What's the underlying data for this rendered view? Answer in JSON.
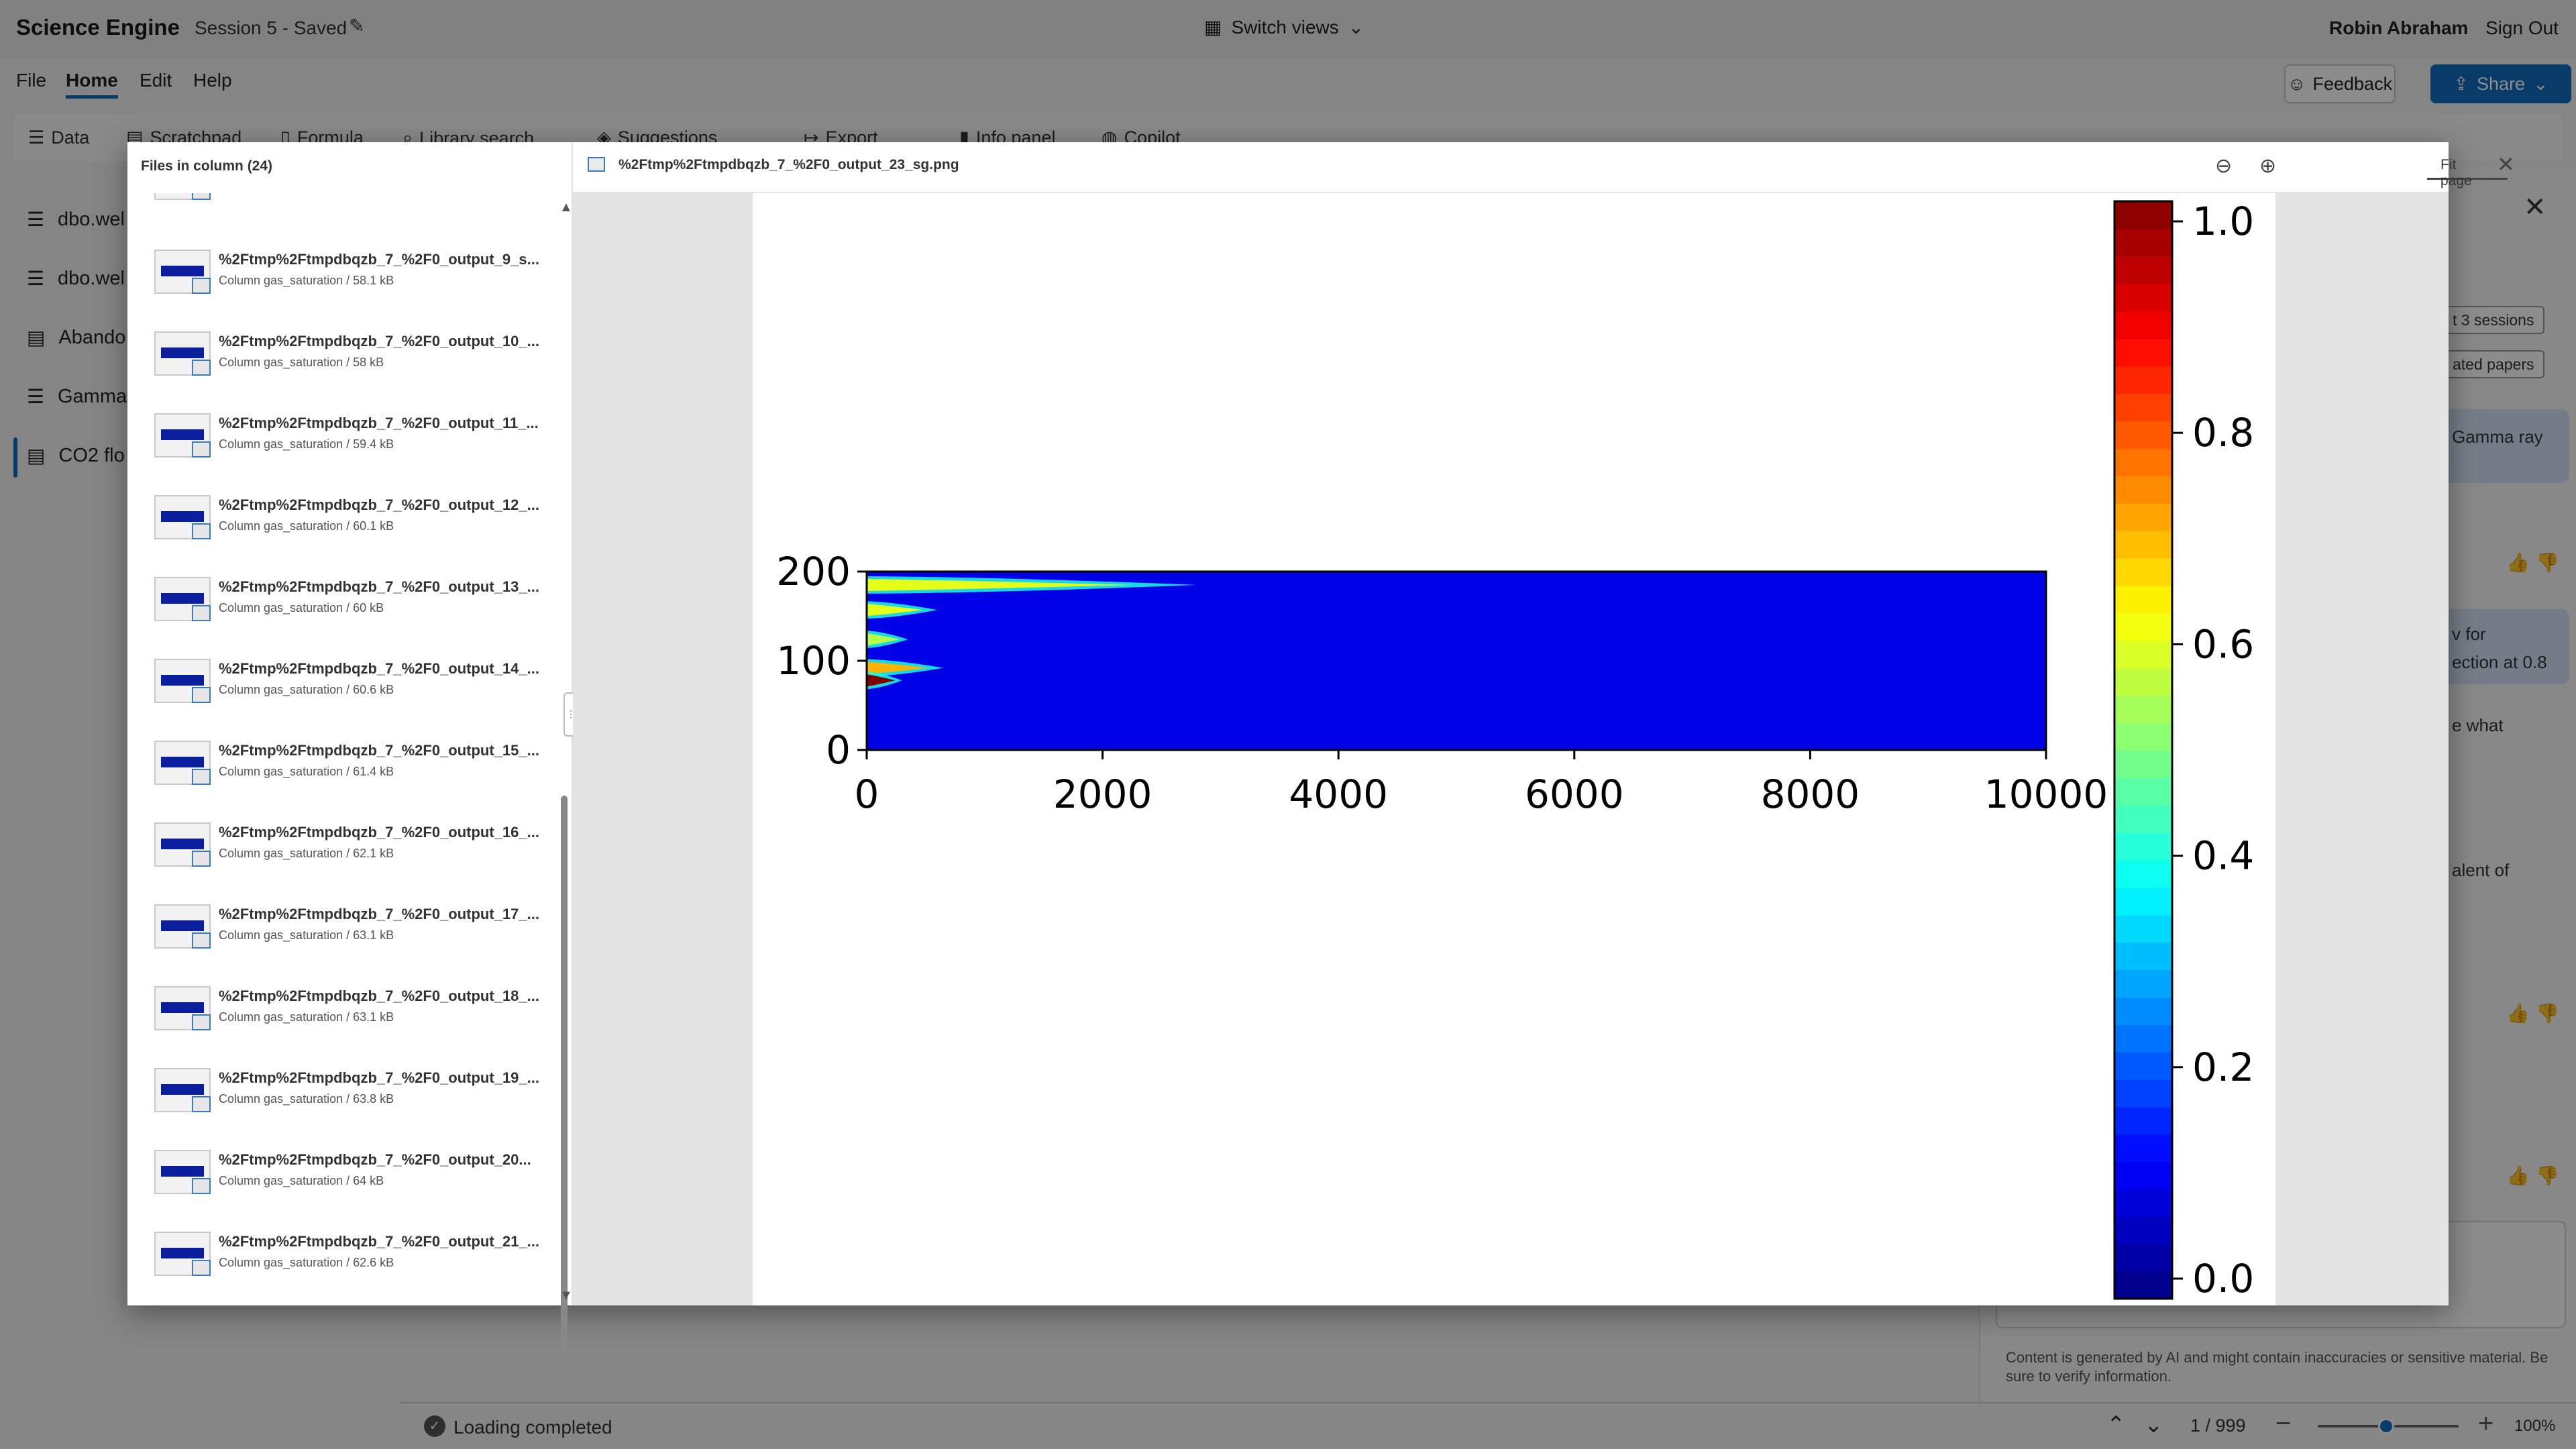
{
  "app": {
    "name": "Science Engine",
    "session": "Session 5 - Saved",
    "switch_views": "Switch views",
    "user": "Robin Abraham",
    "sign_out": "Sign Out"
  },
  "menu": {
    "items": [
      "File",
      "Home",
      "Edit",
      "Help"
    ],
    "active": "Home",
    "feedback": "Feedback",
    "share": "Share"
  },
  "toolbar": {
    "items": [
      "Data",
      "Scratchpad",
      "Formula",
      "Library search",
      "Suggestions",
      "Export",
      "Info panel",
      "Copilot"
    ]
  },
  "sidebar": {
    "items": [
      "dbo.wel",
      "dbo.wel",
      "Abando",
      "Gamma",
      "CO2 flo"
    ]
  },
  "right_panel": {
    "chip1": "t 3 sessions",
    "chip2": "ated papers",
    "bubble1": "Gamma ray",
    "bubble2a": "v for",
    "bubble2b": "ection at 0.8",
    "text1": "e what",
    "text2": "alent of",
    "disclaimer": "Content is generated by AI and might contain inaccuracies or sensitive material. Be sure to verify information."
  },
  "status": {
    "text": "Loading completed",
    "page": "1 / 999",
    "zoom": "100%"
  },
  "modal": {
    "files_header": "Files in column (24)",
    "files": [
      {
        "name": "%2Ftmp%2Ftmpdbqzb_7_%2F0_output_9_s...",
        "meta": "Column gas_saturation / 58.1 kB"
      },
      {
        "name": "%2Ftmp%2Ftmpdbqzb_7_%2F0_output_10_...",
        "meta": "Column gas_saturation / 58 kB"
      },
      {
        "name": "%2Ftmp%2Ftmpdbqzb_7_%2F0_output_11_...",
        "meta": "Column gas_saturation / 59.4 kB"
      },
      {
        "name": "%2Ftmp%2Ftmpdbqzb_7_%2F0_output_12_...",
        "meta": "Column gas_saturation / 60.1 kB"
      },
      {
        "name": "%2Ftmp%2Ftmpdbqzb_7_%2F0_output_13_...",
        "meta": "Column gas_saturation / 60 kB"
      },
      {
        "name": "%2Ftmp%2Ftmpdbqzb_7_%2F0_output_14_...",
        "meta": "Column gas_saturation / 60.6 kB"
      },
      {
        "name": "%2Ftmp%2Ftmpdbqzb_7_%2F0_output_15_...",
        "meta": "Column gas_saturation / 61.4 kB"
      },
      {
        "name": "%2Ftmp%2Ftmpdbqzb_7_%2F0_output_16_...",
        "meta": "Column gas_saturation / 62.1 kB"
      },
      {
        "name": "%2Ftmp%2Ftmpdbqzb_7_%2F0_output_17_...",
        "meta": "Column gas_saturation / 63.1 kB"
      },
      {
        "name": "%2Ftmp%2Ftmpdbqzb_7_%2F0_output_18_...",
        "meta": "Column gas_saturation / 63.1 kB"
      },
      {
        "name": "%2Ftmp%2Ftmpdbqzb_7_%2F0_output_19_...",
        "meta": "Column gas_saturation / 63.8 kB"
      },
      {
        "name": "%2Ftmp%2Ftmpdbqzb_7_%2F0_output_20...",
        "meta": "Column gas_saturation / 64 kB"
      },
      {
        "name": "%2Ftmp%2Ftmpdbqzb_7_%2F0_output_21_...",
        "meta": "Column gas_saturation / 62.6 kB"
      }
    ],
    "viewer_title": "%2Ftmp%2Ftmpdbqzb_7_%2F0_output_23_sg.png",
    "fit_page": "Fit page"
  },
  "chart_data": {
    "type": "heatmap",
    "title": "",
    "xlabel": "",
    "ylabel": "",
    "xlim": [
      0,
      10000
    ],
    "ylim": [
      0,
      200
    ],
    "xticks": [
      0,
      2000,
      4000,
      6000,
      8000,
      10000
    ],
    "yticks": [
      0,
      100,
      200
    ],
    "colorbar": {
      "range": [
        0.0,
        1.0
      ],
      "ticks": [
        "0.0",
        "0.2",
        "0.4",
        "0.6",
        "0.8",
        "1.0"
      ],
      "colormap": "jet"
    },
    "background_value": 0.0,
    "plumes": [
      {
        "y": 185,
        "x_extent": 2800,
        "peak": 0.6
      },
      {
        "y": 157,
        "x_extent": 600,
        "peak": 0.6
      },
      {
        "y": 124,
        "x_extent": 350,
        "peak": 0.55
      },
      {
        "y": 92,
        "x_extent": 650,
        "peak": 0.7
      },
      {
        "y": 78,
        "x_extent": 300,
        "peak": 1.0
      }
    ]
  }
}
